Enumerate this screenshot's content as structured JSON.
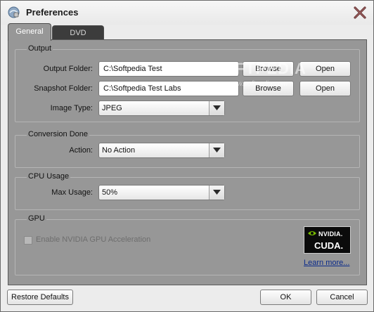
{
  "window": {
    "title": "Preferences",
    "icons": {
      "app": "app-icon",
      "close": "close-icon"
    }
  },
  "tabs": [
    {
      "label": "General",
      "active": true
    },
    {
      "label": "DVD",
      "active": false
    }
  ],
  "output": {
    "group_title": "Output",
    "output_folder_label": "Output Folder:",
    "output_folder_value": "C:\\Softpedia Test",
    "snapshot_folder_label": "Snapshot Folder:",
    "snapshot_folder_value": "C:\\Softpedia Test Labs",
    "browse_label": "Browse",
    "open_label": "Open",
    "image_type_label": "Image Type:",
    "image_type_value": "JPEG"
  },
  "conversion": {
    "group_title": "Conversion Done",
    "action_label": "Action:",
    "action_value": "No Action"
  },
  "cpu": {
    "group_title": "CPU Usage",
    "max_usage_label": "Max Usage:",
    "max_usage_value": "50%"
  },
  "gpu": {
    "group_title": "GPU",
    "enable_label": "Enable NVIDIA GPU Acceleration",
    "enable_checked": false,
    "enable_disabled": true,
    "badge_brand": "NVIDIA.",
    "badge_product": "CUDA.",
    "learn_more": "Learn more..."
  },
  "footer": {
    "restore_label": "Restore Defaults",
    "ok_label": "OK",
    "cancel_label": "Cancel"
  },
  "watermark": {
    "text": "SOFTPEDIA",
    "subtext": "www.softpedia.com"
  },
  "colors": {
    "panel": "#979797",
    "tab_active": "#979797",
    "tab_inactive": "#3c3c3c",
    "link": "#0a2a8a",
    "close_x": "#6a3a3a"
  }
}
